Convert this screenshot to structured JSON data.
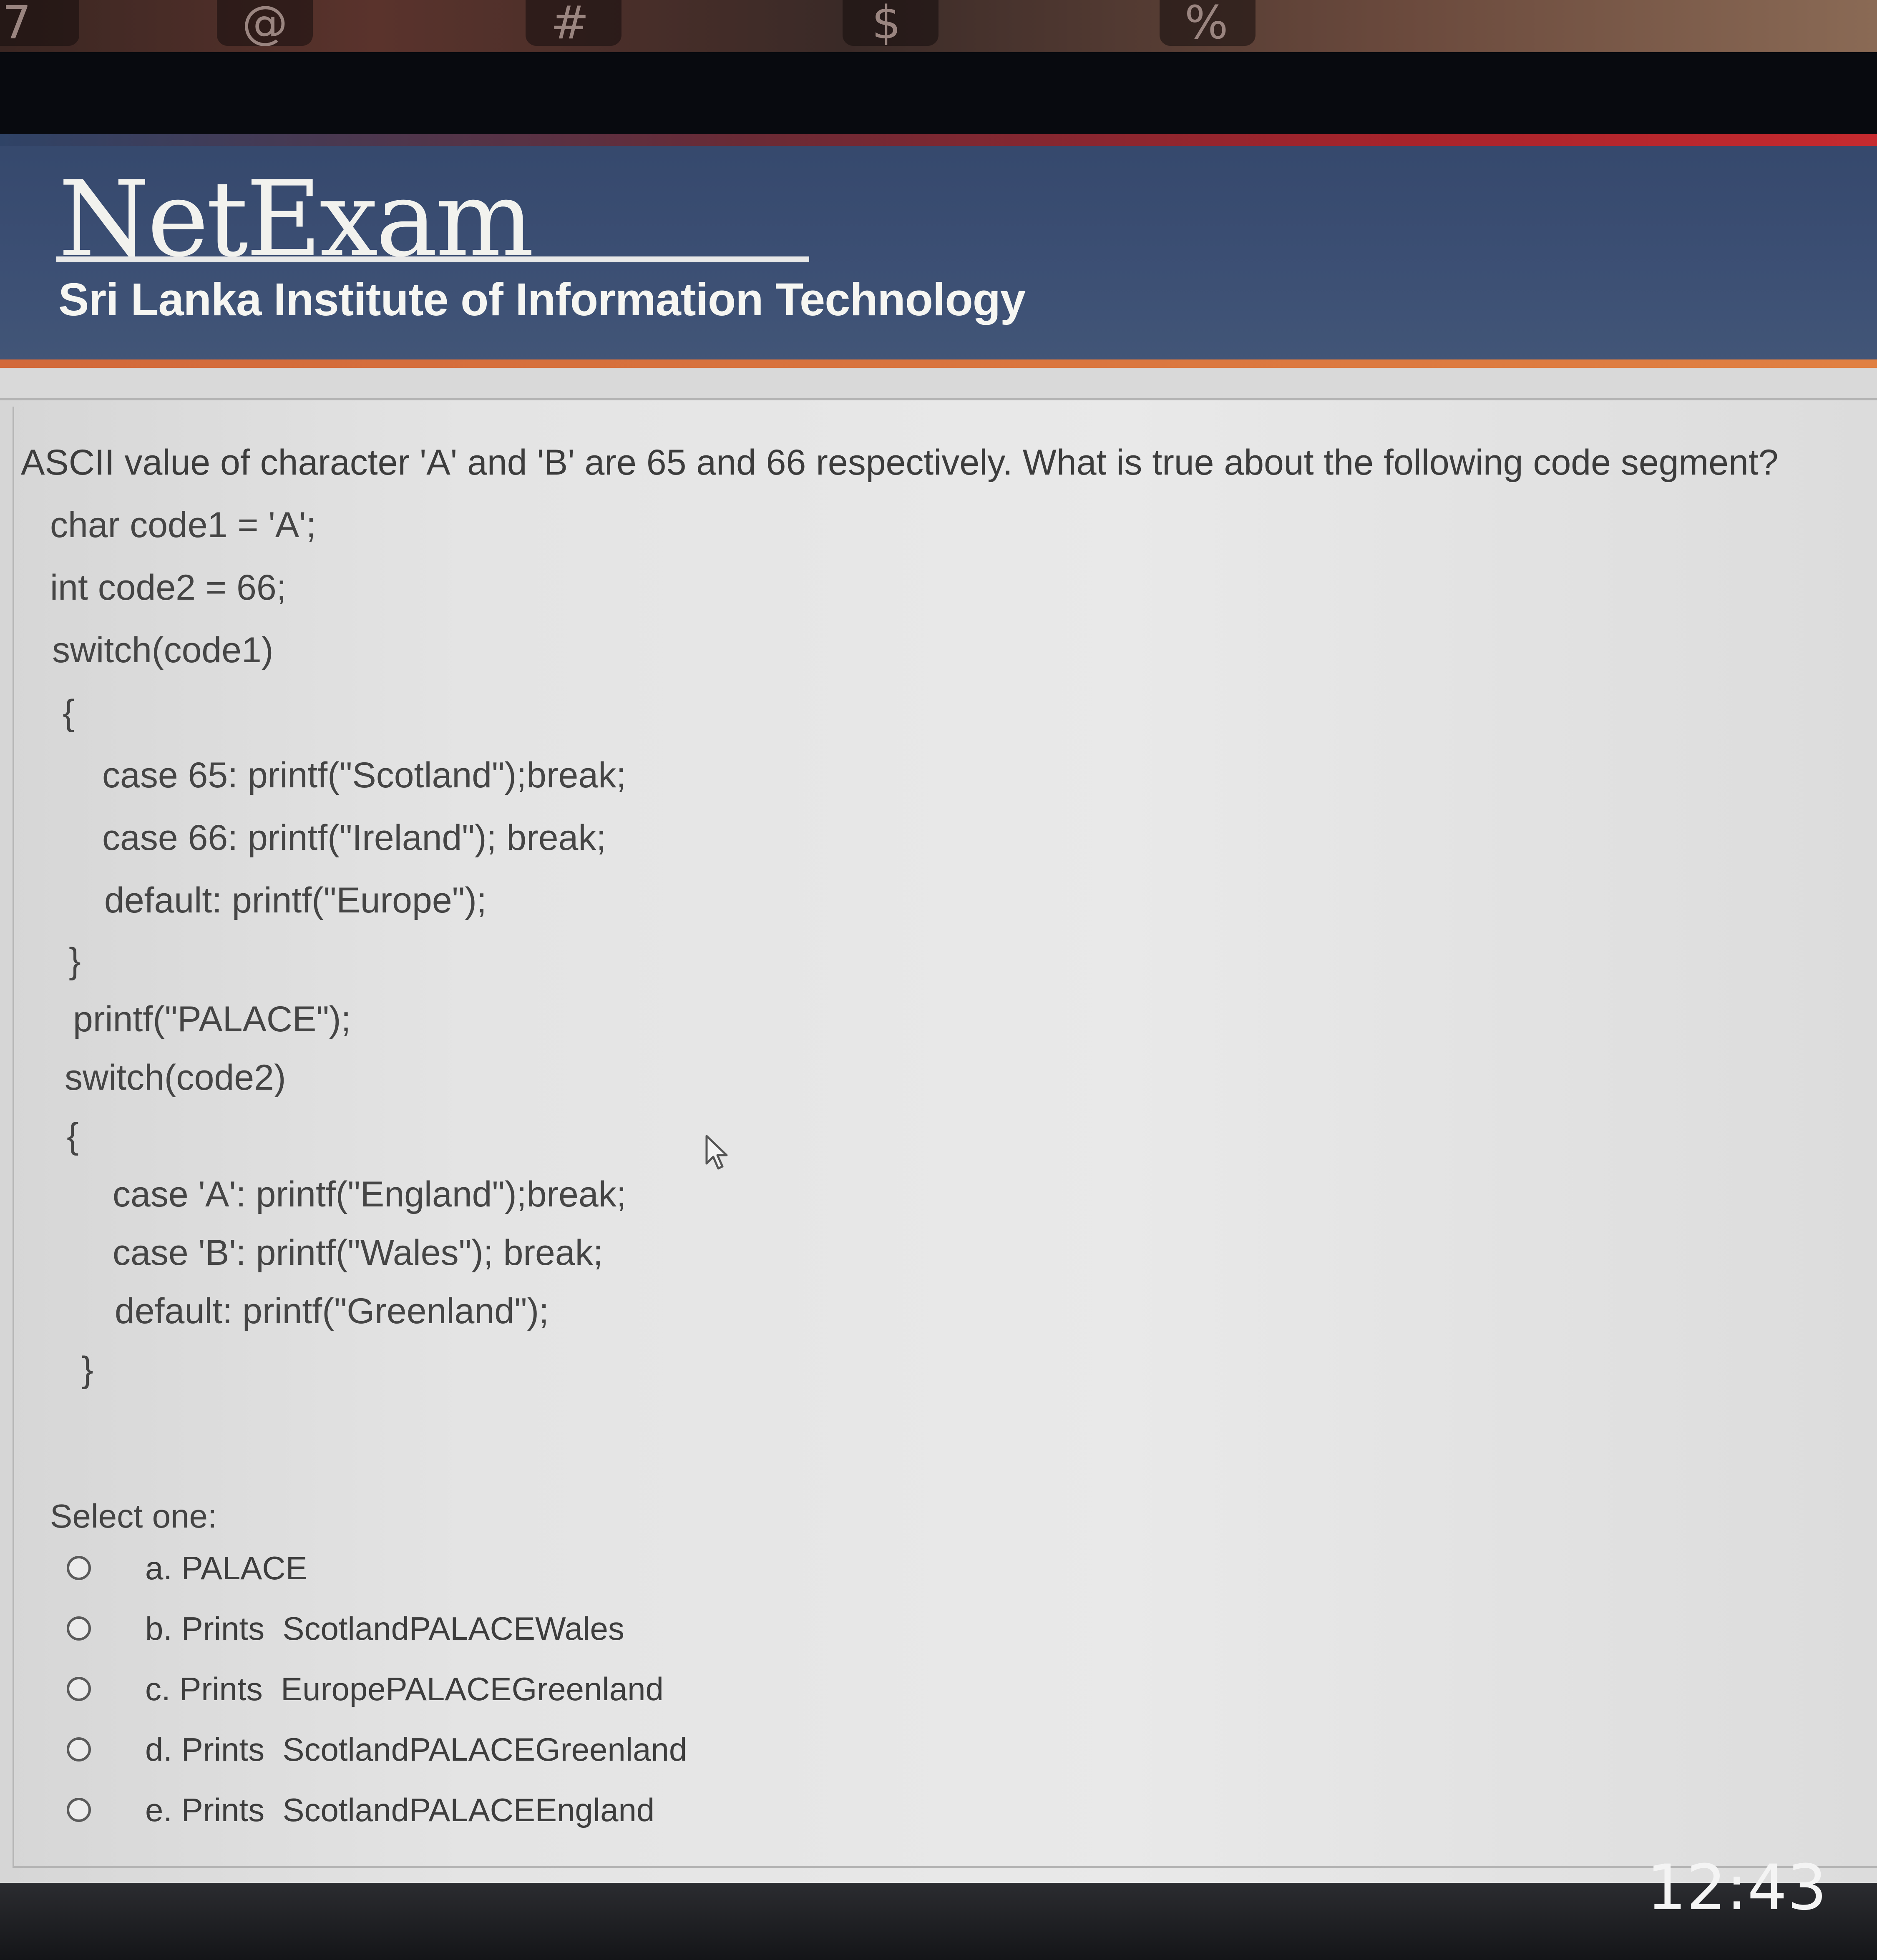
{
  "keyboard": {
    "keys": [
      "7",
      "@",
      "#",
      "$",
      "%"
    ]
  },
  "header": {
    "logo": "NetExam",
    "institute": "Sri Lanka Institute of Information Technology"
  },
  "question": {
    "text": "ASCII value of character 'A' and 'B' are 65 and 66 respectively. What is true about the following code segment?",
    "code": [
      "char code1 = 'A';",
      "int code2 = 66;",
      "switch(code1)",
      "{",
      "case 65: printf(\"Scotland\");break;",
      "case 66: printf(\"Ireland\"); break;",
      "default: printf(\"Europe\");",
      "}",
      "printf(\"PALACE\");",
      "switch(code2)",
      "{",
      "case 'A': printf(\"England\");break;",
      "case 'B': printf(\"Wales\"); break;",
      "default: printf(\"Greenland\");",
      "}"
    ]
  },
  "answers": {
    "select_label": "Select one:",
    "options": [
      {
        "label": "a. PALACE",
        "selected": false
      },
      {
        "label": "b. Prints  ScotlandPALACEWales",
        "selected": false
      },
      {
        "label": "c. Prints  EuropePALACEGreenland",
        "selected": false
      },
      {
        "label": "d. Prints  ScotlandPALACEGreenland",
        "selected": false
      },
      {
        "label": "e. Prints  ScotlandPALACEEngland",
        "selected": false
      }
    ]
  },
  "status": {
    "time": "12:43"
  }
}
